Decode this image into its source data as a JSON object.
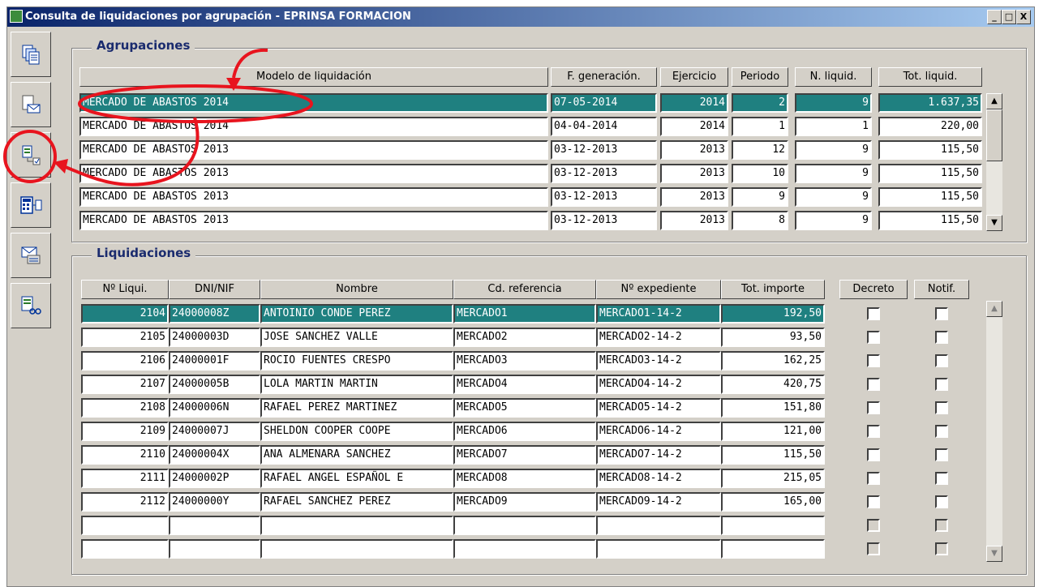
{
  "window": {
    "title": "Consulta de liquidaciones por agrupación - EPRINSA FORMACION",
    "controls": [
      "_",
      "□",
      "X"
    ]
  },
  "toolbar": {
    "buttons": [
      {
        "icon": "copy-documents-icon"
      },
      {
        "icon": "document-mail-icon"
      },
      {
        "icon": "document-export-icon"
      },
      {
        "icon": "calculator-copy-icon"
      },
      {
        "icon": "mail-card-icon"
      },
      {
        "icon": "document-search-icon"
      }
    ]
  },
  "agrupaciones": {
    "title": "Agrupaciones",
    "headers": [
      "Modelo de liquidación",
      "F. generación.",
      "Ejercicio",
      "Periodo",
      "N. liquid.",
      "Tot. liquid."
    ],
    "rows": [
      {
        "modelo": "MERCADO DE ABASTOS 2014",
        "fecha": "07-05-2014",
        "ejercicio": "2014",
        "periodo": "2",
        "n_liquid": "9",
        "tot_liquid": "1.637,35"
      },
      {
        "modelo": "MERCADO DE ABASTOS 2014",
        "fecha": "04-04-2014",
        "ejercicio": "2014",
        "periodo": "1",
        "n_liquid": "1",
        "tot_liquid": "220,00"
      },
      {
        "modelo": "MERCADO DE ABASTOS 2013",
        "fecha": "03-12-2013",
        "ejercicio": "2013",
        "periodo": "12",
        "n_liquid": "9",
        "tot_liquid": "115,50"
      },
      {
        "modelo": "MERCADO DE ABASTOS 2013",
        "fecha": "03-12-2013",
        "ejercicio": "2013",
        "periodo": "10",
        "n_liquid": "9",
        "tot_liquid": "115,50"
      },
      {
        "modelo": "MERCADO DE ABASTOS 2013",
        "fecha": "03-12-2013",
        "ejercicio": "2013",
        "periodo": "9",
        "n_liquid": "9",
        "tot_liquid": "115,50"
      },
      {
        "modelo": "MERCADO DE ABASTOS 2013",
        "fecha": "03-12-2013",
        "ejercicio": "2013",
        "periodo": "8",
        "n_liquid": "9",
        "tot_liquid": "115,50"
      }
    ],
    "selected_index": 0
  },
  "liquidaciones": {
    "title": "Liquidaciones",
    "headers": [
      "Nº Liqui.",
      "DNI/NIF",
      "Nombre",
      "Cd. referencia",
      "Nº expediente",
      "Tot. importe",
      "Decreto",
      "Notif."
    ],
    "rows": [
      {
        "num": "2104",
        "dni": "24000008Z",
        "nombre": "ANTOINIO CONDE PEREZ",
        "ref": "MERCADO1",
        "exp": "MERCADO1-14-2",
        "importe": "192,50"
      },
      {
        "num": "2105",
        "dni": "24000003D",
        "nombre": "JOSE SANCHEZ VALLE",
        "ref": "MERCADO2",
        "exp": "MERCADO2-14-2",
        "importe": "93,50"
      },
      {
        "num": "2106",
        "dni": "24000001F",
        "nombre": "ROCIO FUENTES CRESPO",
        "ref": "MERCADO3",
        "exp": "MERCADO3-14-2",
        "importe": "162,25"
      },
      {
        "num": "2107",
        "dni": "24000005B",
        "nombre": "LOLA MARTIN MARTIN",
        "ref": "MERCADO4",
        "exp": "MERCADO4-14-2",
        "importe": "420,75"
      },
      {
        "num": "2108",
        "dni": "24000006N",
        "nombre": "RAFAEL PEREZ MARTINEZ",
        "ref": "MERCADO5",
        "exp": "MERCADO5-14-2",
        "importe": "151,80"
      },
      {
        "num": "2109",
        "dni": "24000007J",
        "nombre": "SHELDON COOPER COOPE",
        "ref": "MERCADO6",
        "exp": "MERCADO6-14-2",
        "importe": "121,00"
      },
      {
        "num": "2110",
        "dni": "24000004X",
        "nombre": "ANA ALMENARA SANCHEZ",
        "ref": "MERCADO7",
        "exp": "MERCADO7-14-2",
        "importe": "115,50"
      },
      {
        "num": "2111",
        "dni": "24000002P",
        "nombre": "RAFAEL ANGEL ESPAÑOL E",
        "ref": "MERCADO8",
        "exp": "MERCADO8-14-2",
        "importe": "215,05"
      },
      {
        "num": "2112",
        "dni": "24000000Y",
        "nombre": "RAFAEL SANCHEZ PEREZ",
        "ref": "MERCADO9",
        "exp": "MERCADO9-14-2",
        "importe": "165,00"
      }
    ],
    "empty_rows": 2,
    "selected_index": 0
  },
  "colors": {
    "selection": "#1f8080",
    "title_gradient_start": "#0a246a",
    "annotation": "#e8141e",
    "group_title": "#1a2b6e"
  }
}
